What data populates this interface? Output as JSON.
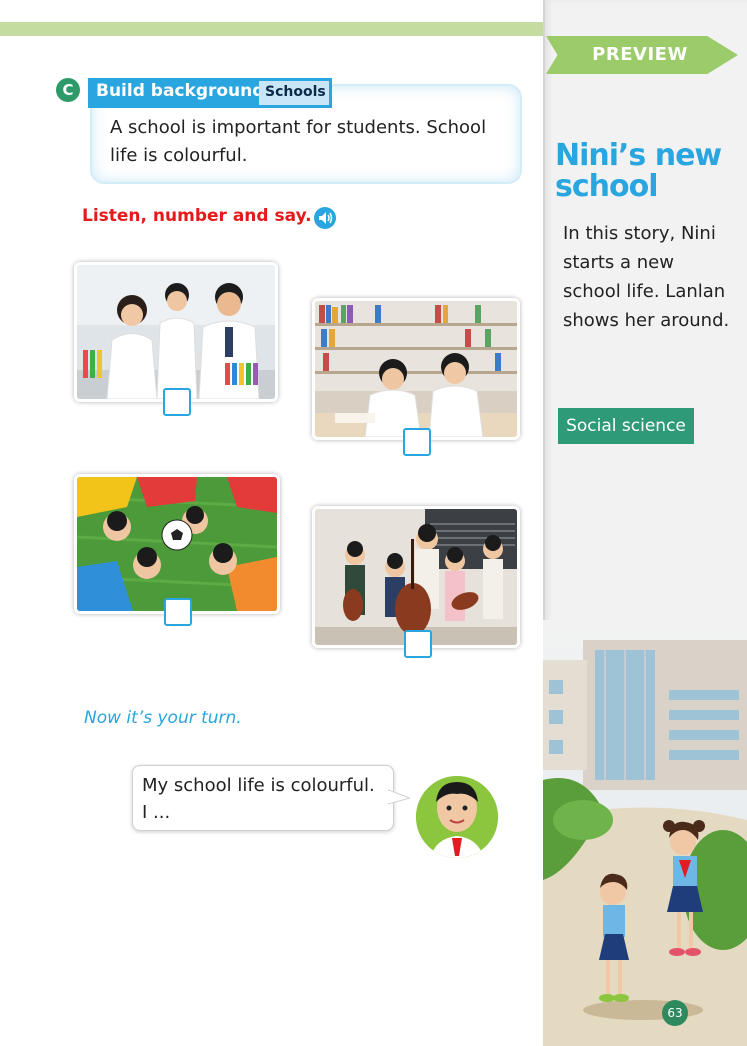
{
  "header": {
    "tab_label": "PREVIEW"
  },
  "section": {
    "badge": "C",
    "title": "Build background",
    "subtitle": "Schools",
    "body": "A school is important for students. School life is colourful."
  },
  "activity": {
    "instruction": "Listen, number and say.",
    "photos": [
      {
        "name": "science lab"
      },
      {
        "name": "library"
      },
      {
        "name": "football"
      },
      {
        "name": "music"
      }
    ]
  },
  "your_turn": {
    "prompt": "Now it’s your turn.",
    "bubble_line1": "My school life is colourful.",
    "bubble_line2": "I ..."
  },
  "sidebar": {
    "story_title": "Nini’s new school",
    "description": "In this story, Nini starts a new school life. Lanlan shows her around.",
    "subject": "Social science",
    "page_number": "63"
  },
  "colors": {
    "accent_blue": "#29a5df",
    "accent_green": "#2e9a78",
    "instruction_red": "#e51a1a",
    "preview_green": "#9ccb6a"
  }
}
